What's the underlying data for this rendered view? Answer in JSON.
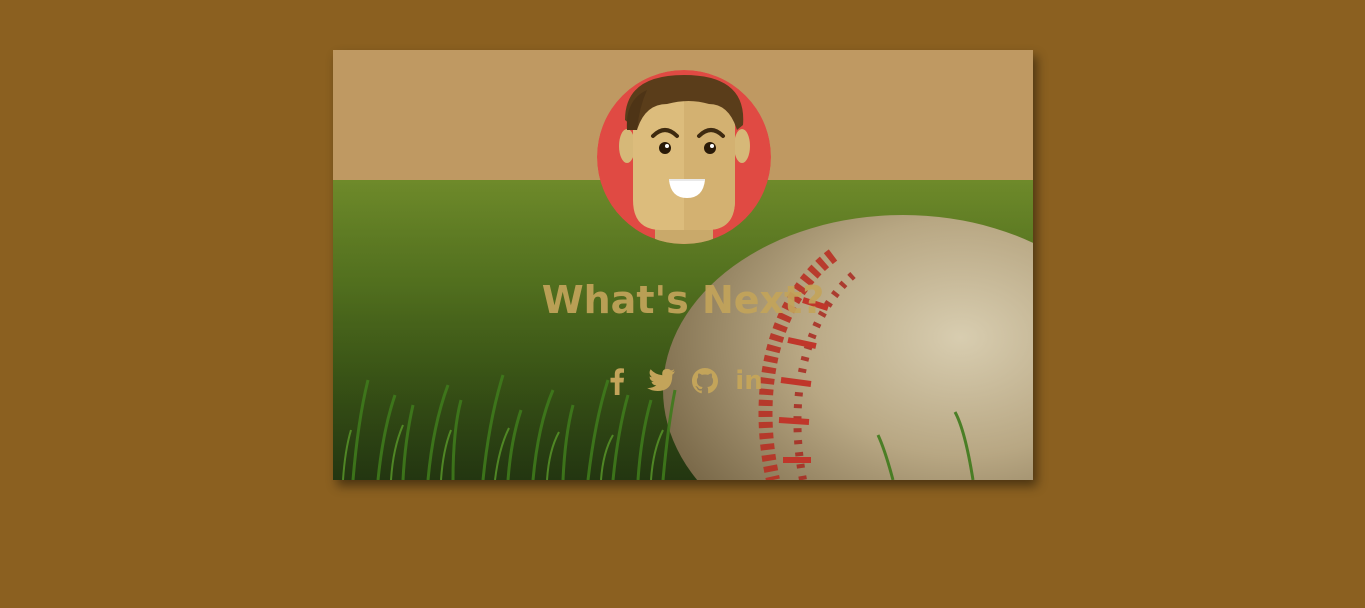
{
  "page": {
    "background_color": "#8b6020"
  },
  "card": {
    "top_band_color": "#bf9962",
    "headline": "What's Next?",
    "accent_color": "#c3a45a",
    "avatar": {
      "icon": "cartoon-face-avatar",
      "ring_color": "#e04a43"
    },
    "social_links": [
      {
        "id": "facebook",
        "icon": "facebook-icon"
      },
      {
        "id": "twitter",
        "icon": "twitter-icon"
      },
      {
        "id": "github",
        "icon": "github-icon"
      },
      {
        "id": "linkedin",
        "icon": "linkedin-icon",
        "label": "in"
      }
    ]
  }
}
